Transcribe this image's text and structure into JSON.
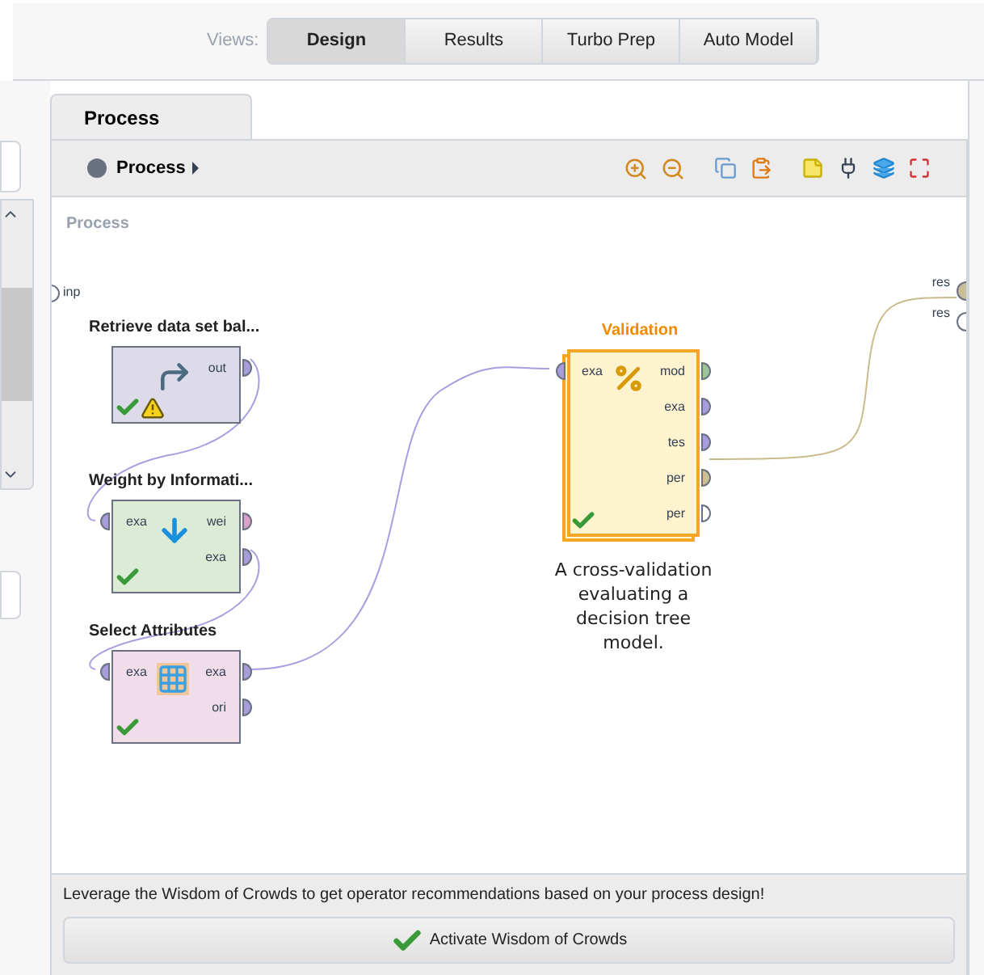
{
  "views": {
    "label": "Views:",
    "buttons": [
      {
        "label": "Design",
        "selected": true
      },
      {
        "label": "Results",
        "selected": false
      },
      {
        "label": "Turbo Prep",
        "selected": false
      },
      {
        "label": "Auto Model",
        "selected": false
      }
    ]
  },
  "tab": {
    "label": "Process",
    "selected": true
  },
  "breadcrumb": "Process",
  "canvas": {
    "label": "Process",
    "input_port": "inp",
    "result_ports": [
      {
        "label": "res",
        "color": "#c8bf98"
      },
      {
        "label": "res",
        "color": "#ffffff"
      }
    ],
    "operators": [
      {
        "name": "Retrieve data set bal...",
        "color": "#dddbea",
        "selected": false,
        "ok": true,
        "warning": true,
        "outputs": [
          {
            "label": "out",
            "color": "#a79ddb"
          }
        ]
      },
      {
        "name": "Weight by Informati...",
        "color": "#dcebd6",
        "selected": false,
        "ok": true,
        "inputs": [
          {
            "label": "exa",
            "color": "#a79ddb"
          }
        ],
        "outputs": [
          {
            "label": "wei",
            "color": "#d9a0c8"
          },
          {
            "label": "exa",
            "color": "#a79ddb"
          }
        ]
      },
      {
        "name": "Select Attributes",
        "color": "#f1dcea",
        "selected": false,
        "ok": true,
        "inputs": [
          {
            "label": "exa",
            "color": "#a79ddb"
          }
        ],
        "outputs": [
          {
            "label": "exa",
            "color": "#a79ddb"
          },
          {
            "label": "ori",
            "color": "#a79ddb"
          }
        ]
      },
      {
        "name": "Validation",
        "color": "#fdf3cf",
        "selected": true,
        "ok": true,
        "inputs": [
          {
            "label": "exa",
            "color": "#a79ddb"
          }
        ],
        "outputs": [
          {
            "label": "mod",
            "color": "#9bc49b"
          },
          {
            "label": "exa",
            "color": "#a79ddb"
          },
          {
            "label": "tes",
            "color": "#a79ddb"
          },
          {
            "label": "per",
            "color": "#c8bf98"
          },
          {
            "label": "per",
            "color": "#ffffff"
          }
        ]
      }
    ],
    "note": "A cross-validation evaluating a decision tree model."
  },
  "wisdom": {
    "message": "Leverage the Wisdom of Crowds to get operator recommendations based on your process design!",
    "button": "Activate Wisdom of Crowds"
  }
}
